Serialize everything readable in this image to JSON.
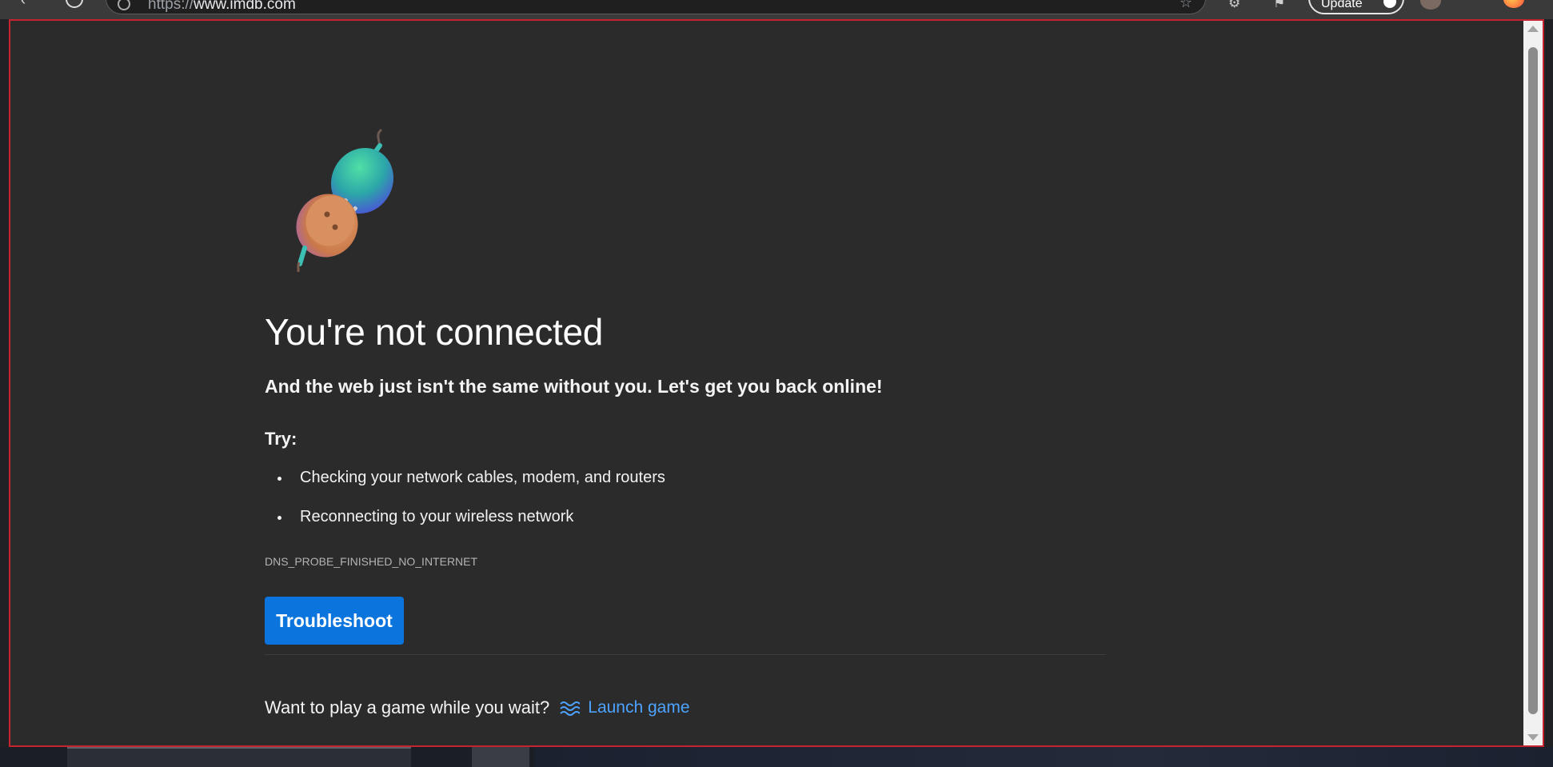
{
  "browser": {
    "url_prefix": "https://",
    "url_host": "www.imdb.com",
    "update_label": "Update"
  },
  "error_page": {
    "title": "You're not connected",
    "subtitle": "And the web just isn't the same without you. Let's get you back online!",
    "try_label": "Try:",
    "suggestions": [
      "Checking your network cables, modem, and routers",
      "Reconnecting to your wireless network"
    ],
    "error_code": "DNS_PROBE_FINISHED_NO_INTERNET",
    "troubleshoot_label": "Troubleshoot",
    "game_prompt": "Want to play a game while you wait?",
    "game_link_label": "Launch game"
  },
  "colors": {
    "page_background": "#2b2b2b",
    "button_primary": "#0b74dd",
    "link": "#4da3ff",
    "frame_border": "#c4232f"
  },
  "icons": {
    "illustration": "unplugged-plug-illustration",
    "game": "waves-icon"
  }
}
